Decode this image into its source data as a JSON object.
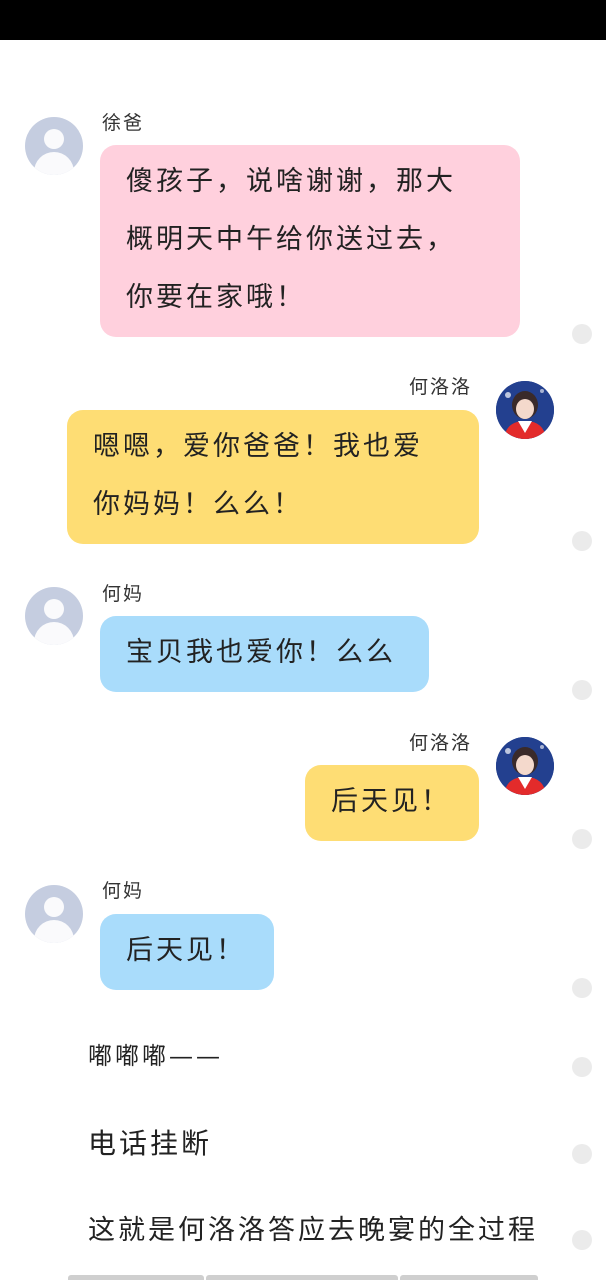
{
  "messages": [
    {
      "sender": "徐爸",
      "lines": [
        "傻孩子，说啥谢谢，那大",
        "概明天中午给你送过去，",
        "你要在家哦！"
      ],
      "color": "#ffd0dd"
    },
    {
      "sender": "何洛洛",
      "lines": [
        "嗯嗯，爱你爸爸！我也爱",
        "你妈妈！么么！"
      ],
      "color": "#fedd74"
    },
    {
      "sender": "何妈",
      "lines": [
        "宝贝我也爱你！么么"
      ],
      "color": "#a9dcfb"
    },
    {
      "sender": "何洛洛",
      "lines": [
        "后天见！"
      ],
      "color": "#fedd74"
    },
    {
      "sender": "何妈",
      "lines": [
        "后天见！"
      ],
      "color": "#a9dcfb"
    }
  ],
  "narration": [
    "嘟嘟嘟——",
    "电话挂断",
    "这就是何洛洛答应去晚宴的全过程"
  ],
  "icons": {
    "default_avatar": "default-user-avatar",
    "user_avatar": "user-photo-avatar"
  }
}
